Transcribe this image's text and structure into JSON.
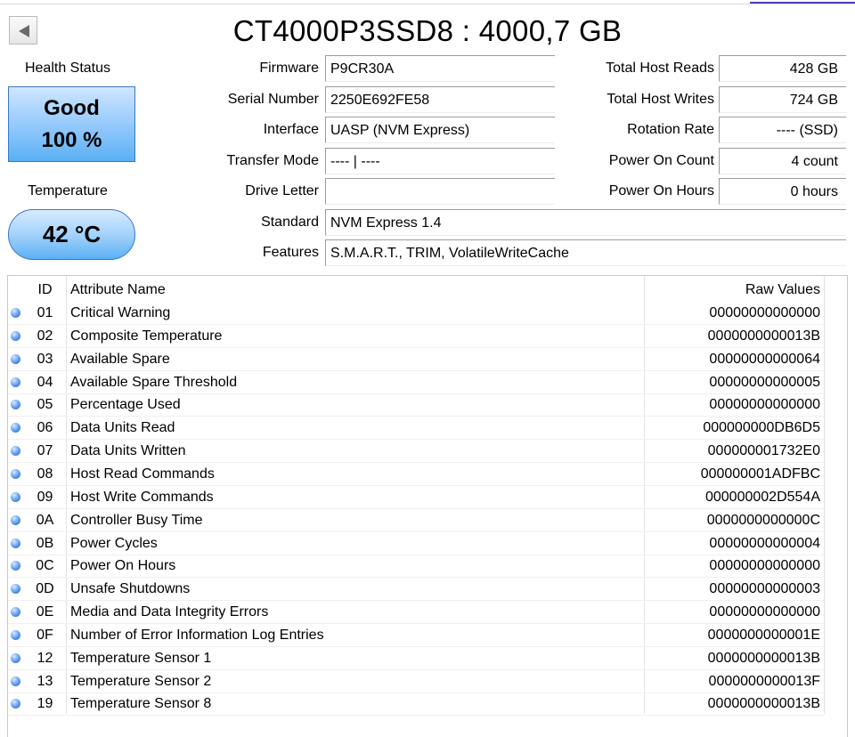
{
  "title": "CT4000P3SSD8 : 4000,7 GB",
  "health": {
    "label": "Health Status",
    "status": "Good",
    "percent": "100 %"
  },
  "temperature": {
    "label": "Temperature",
    "value": "42 °C"
  },
  "info_left": [
    {
      "label": "Firmware",
      "value": "P9CR30A"
    },
    {
      "label": "Serial Number",
      "value": "2250E692FE58"
    },
    {
      "label": "Interface",
      "value": "UASP (NVM Express)"
    },
    {
      "label": "Transfer Mode",
      "value": "---- | ----"
    },
    {
      "label": "Drive Letter",
      "value": ""
    }
  ],
  "info_right": [
    {
      "label": "Total Host Reads",
      "value": "428 GB"
    },
    {
      "label": "Total Host Writes",
      "value": "724 GB"
    },
    {
      "label": "Rotation Rate",
      "value": "---- (SSD)"
    },
    {
      "label": "Power On Count",
      "value": "4 count"
    },
    {
      "label": "Power On Hours",
      "value": "0 hours"
    }
  ],
  "standard": {
    "label": "Standard",
    "value": "NVM Express 1.4"
  },
  "features": {
    "label": "Features",
    "value": "S.M.A.R.T., TRIM, VolatileWriteCache"
  },
  "table": {
    "headers": {
      "id": "ID",
      "name": "Attribute Name",
      "raw": "Raw Values"
    },
    "rows": [
      {
        "id": "01",
        "name": "Critical Warning",
        "raw": "00000000000000"
      },
      {
        "id": "02",
        "name": "Composite Temperature",
        "raw": "0000000000013B"
      },
      {
        "id": "03",
        "name": "Available Spare",
        "raw": "00000000000064"
      },
      {
        "id": "04",
        "name": "Available Spare Threshold",
        "raw": "00000000000005"
      },
      {
        "id": "05",
        "name": "Percentage Used",
        "raw": "00000000000000"
      },
      {
        "id": "06",
        "name": "Data Units Read",
        "raw": "000000000DB6D5"
      },
      {
        "id": "07",
        "name": "Data Units Written",
        "raw": "000000001732E0"
      },
      {
        "id": "08",
        "name": "Host Read Commands",
        "raw": "000000001ADFBC"
      },
      {
        "id": "09",
        "name": "Host Write Commands",
        "raw": "000000002D554A"
      },
      {
        "id": "0A",
        "name": "Controller Busy Time",
        "raw": "0000000000000C"
      },
      {
        "id": "0B",
        "name": "Power Cycles",
        "raw": "00000000000004"
      },
      {
        "id": "0C",
        "name": "Power On Hours",
        "raw": "00000000000000"
      },
      {
        "id": "0D",
        "name": "Unsafe Shutdowns",
        "raw": "00000000000003"
      },
      {
        "id": "0E",
        "name": "Media and Data Integrity Errors",
        "raw": "00000000000000"
      },
      {
        "id": "0F",
        "name": "Number of Error Information Log Entries",
        "raw": "0000000000001E"
      },
      {
        "id": "12",
        "name": "Temperature Sensor 1",
        "raw": "0000000000013B"
      },
      {
        "id": "13",
        "name": "Temperature Sensor 2",
        "raw": "0000000000013F"
      },
      {
        "id": "19",
        "name": "Temperature Sensor 8",
        "raw": "0000000000013B"
      }
    ]
  },
  "colors": {
    "status_good": "#5ab0f4",
    "status_dot": "#1d57c7",
    "accent": "#4b3fb5"
  },
  "icons": {
    "back": "back-arrow-icon",
    "status": "status-dot-icon"
  }
}
